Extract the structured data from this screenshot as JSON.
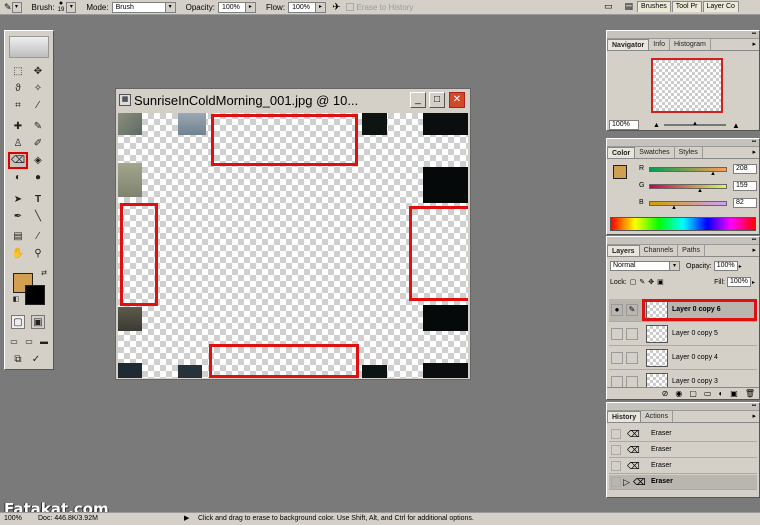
{
  "options_bar": {
    "brush_label": "Brush:",
    "brush_size": "19",
    "mode_label": "Mode:",
    "mode_value": "Brush",
    "opacity_label": "Opacity:",
    "opacity_value": "100%",
    "flow_label": "Flow:",
    "flow_value": "100%",
    "erase_to_history": "Erase to History",
    "well_tabs": [
      "Brushes",
      "Tool Pr",
      "Layer Co"
    ]
  },
  "document": {
    "title": "SunriseInColdMorning_001.jpg @ 10..."
  },
  "toolbox": {
    "foreground_color": "#d09f52",
    "background_color": "#000000"
  },
  "navigator": {
    "tabs": [
      "Navigator",
      "Info",
      "Histogram"
    ],
    "zoom": "100%"
  },
  "color_panel": {
    "tabs": [
      "Color",
      "Swatches",
      "Styles"
    ],
    "r_label": "R",
    "r_value": "208",
    "g_label": "G",
    "g_value": "159",
    "b_label": "B",
    "b_value": "82"
  },
  "layers_panel": {
    "tabs": [
      "Layers",
      "Channels",
      "Paths"
    ],
    "blend_mode": "Normal",
    "opacity_label": "Opacity:",
    "opacity_value": "100%",
    "lock_label": "Lock:",
    "fill_label": "Fill:",
    "fill_value": "100%",
    "layers": [
      "Layer 0 copy 6",
      "Layer 0 copy 5",
      "Layer 0 copy 4",
      "Layer 0 copy 3"
    ]
  },
  "history_panel": {
    "tabs": [
      "History",
      "Actions"
    ],
    "items": [
      "Eraser",
      "Eraser",
      "Eraser",
      "Eraser"
    ]
  },
  "status_bar": {
    "zoom": "100%",
    "doc_info": "Doc: 446.8K/3.92M",
    "hint": "Click and drag to erase to background color.  Use Shift, Alt, and Ctrl for additional options."
  },
  "watermark": "Fatakat.com"
}
